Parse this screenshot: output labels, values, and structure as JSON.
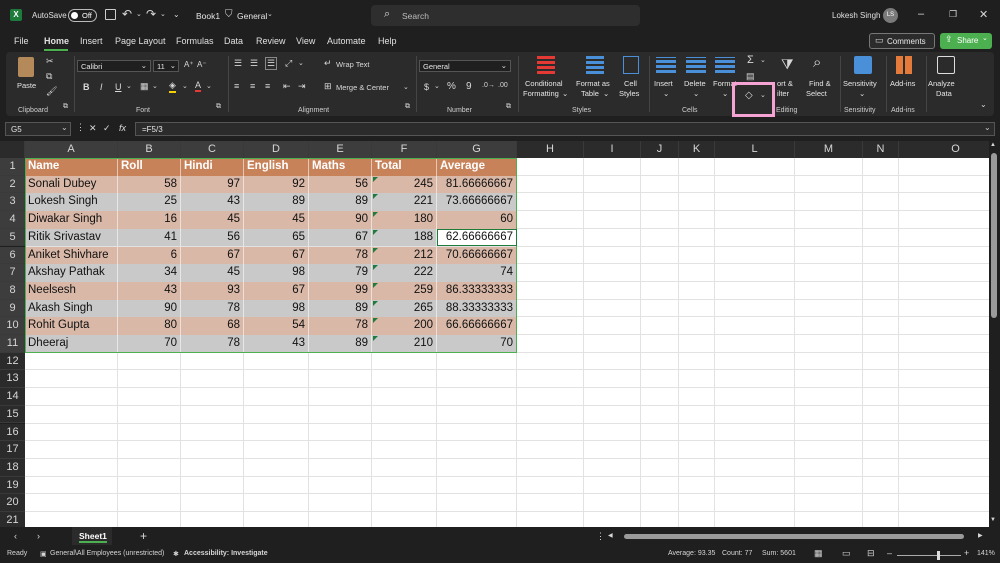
{
  "titlebar": {
    "autosave_label": "AutoSave",
    "autosave_state": "Off",
    "book_name": "Book1",
    "sensitivity": "General",
    "search_placeholder": "Search",
    "user_name": "Lokesh Singh",
    "user_initials": "LS"
  },
  "menu": {
    "items": [
      "File",
      "Home",
      "Insert",
      "Page Layout",
      "Formulas",
      "Data",
      "Review",
      "View",
      "Automate",
      "Help"
    ],
    "active": "Home",
    "comments_label": "Comments",
    "share_label": "Share"
  },
  "ribbon": {
    "clipboard": {
      "paste": "Paste",
      "label": "Clipboard"
    },
    "font": {
      "name": "Calibri",
      "size": "11",
      "label": "Font",
      "bold": "B",
      "italic": "I",
      "underline": "U"
    },
    "alignment": {
      "wrap": "Wrap Text",
      "merge": "Merge & Center",
      "label": "Alignment"
    },
    "number": {
      "format": "General",
      "label": "Number",
      "currency": "$",
      "percent": "%",
      "comma": "9"
    },
    "styles": {
      "conditional_line1": "Conditional",
      "conditional_line2": "Formatting",
      "format_table_line1": "Format as",
      "format_table_line2": "Table",
      "cell_styles_line1": "Cell",
      "cell_styles_line2": "Styles",
      "label": "Styles"
    },
    "cells": {
      "insert": "Insert",
      "delete": "Delete",
      "format": "Format",
      "label": "Cells"
    },
    "editing": {
      "sort_line1": "ort &",
      "sort_line2": "ilter",
      "find_line1": "Find &",
      "find_line2": "Select",
      "label": "Editing"
    },
    "sensitivity": {
      "btn": "Sensitivity",
      "label": "Sensitivity"
    },
    "addins": {
      "btn": "Add-ins",
      "label": "Add-ins"
    },
    "analyze": {
      "line1": "Analyze",
      "line2": "Data"
    }
  },
  "formula_bar": {
    "name_box": "G5",
    "fx": "fx",
    "formula": "=F5/3"
  },
  "columns": [
    "A",
    "B",
    "C",
    "D",
    "E",
    "F",
    "G",
    "H",
    "I",
    "J",
    "K",
    "L",
    "M",
    "N",
    "O"
  ],
  "rows": [
    "1",
    "2",
    "3",
    "4",
    "5",
    "6",
    "7",
    "8",
    "9",
    "10",
    "11",
    "12",
    "13",
    "14",
    "15",
    "16",
    "17",
    "18",
    "19",
    "20",
    "21"
  ],
  "table": {
    "headers": [
      "Name",
      "Roll",
      "Hindi",
      "English",
      "Maths",
      "Total",
      "Average"
    ],
    "rows": [
      [
        "Sonali Dubey",
        "58",
        "97",
        "92",
        "56",
        "245",
        "81.66666667"
      ],
      [
        "Lokesh Singh",
        "25",
        "43",
        "89",
        "89",
        "221",
        "73.66666667"
      ],
      [
        "Diwakar Singh",
        "16",
        "45",
        "45",
        "90",
        "180",
        "60"
      ],
      [
        "Ritik Srivastav",
        "41",
        "56",
        "65",
        "67",
        "188",
        "62.66666667"
      ],
      [
        "Aniket Shivhare",
        "6",
        "67",
        "67",
        "78",
        "212",
        "70.66666667"
      ],
      [
        "Akshay Pathak",
        "34",
        "45",
        "98",
        "79",
        "222",
        "74"
      ],
      [
        "Neelsesh",
        "43",
        "93",
        "67",
        "99",
        "259",
        "86.33333333"
      ],
      [
        "Akash Singh",
        "90",
        "78",
        "98",
        "89",
        "265",
        "88.33333333"
      ],
      [
        "Rohit Gupta",
        "80",
        "68",
        "54",
        "78",
        "200",
        "66.66666667"
      ],
      [
        "Dheeraj",
        "70",
        "78",
        "43",
        "89",
        "210",
        "70"
      ]
    ]
  },
  "colors": {
    "header_fill": "#c8825a",
    "band_fill": "#d9b8a8",
    "alt_fill": "#c9c9c9",
    "accent": "#4caf50",
    "highlight": "#f5a3d3"
  },
  "sheet_tabs": {
    "active": "Sheet1",
    "add": "+"
  },
  "status": {
    "ready": "Ready",
    "sensitivity": "General\\All Employees (unrestricted)",
    "accessibility": "Accessibility: Investigate",
    "average": "Average: 93.35",
    "count": "Count: 77",
    "sum": "Sum: 5601",
    "zoom": "141%"
  }
}
